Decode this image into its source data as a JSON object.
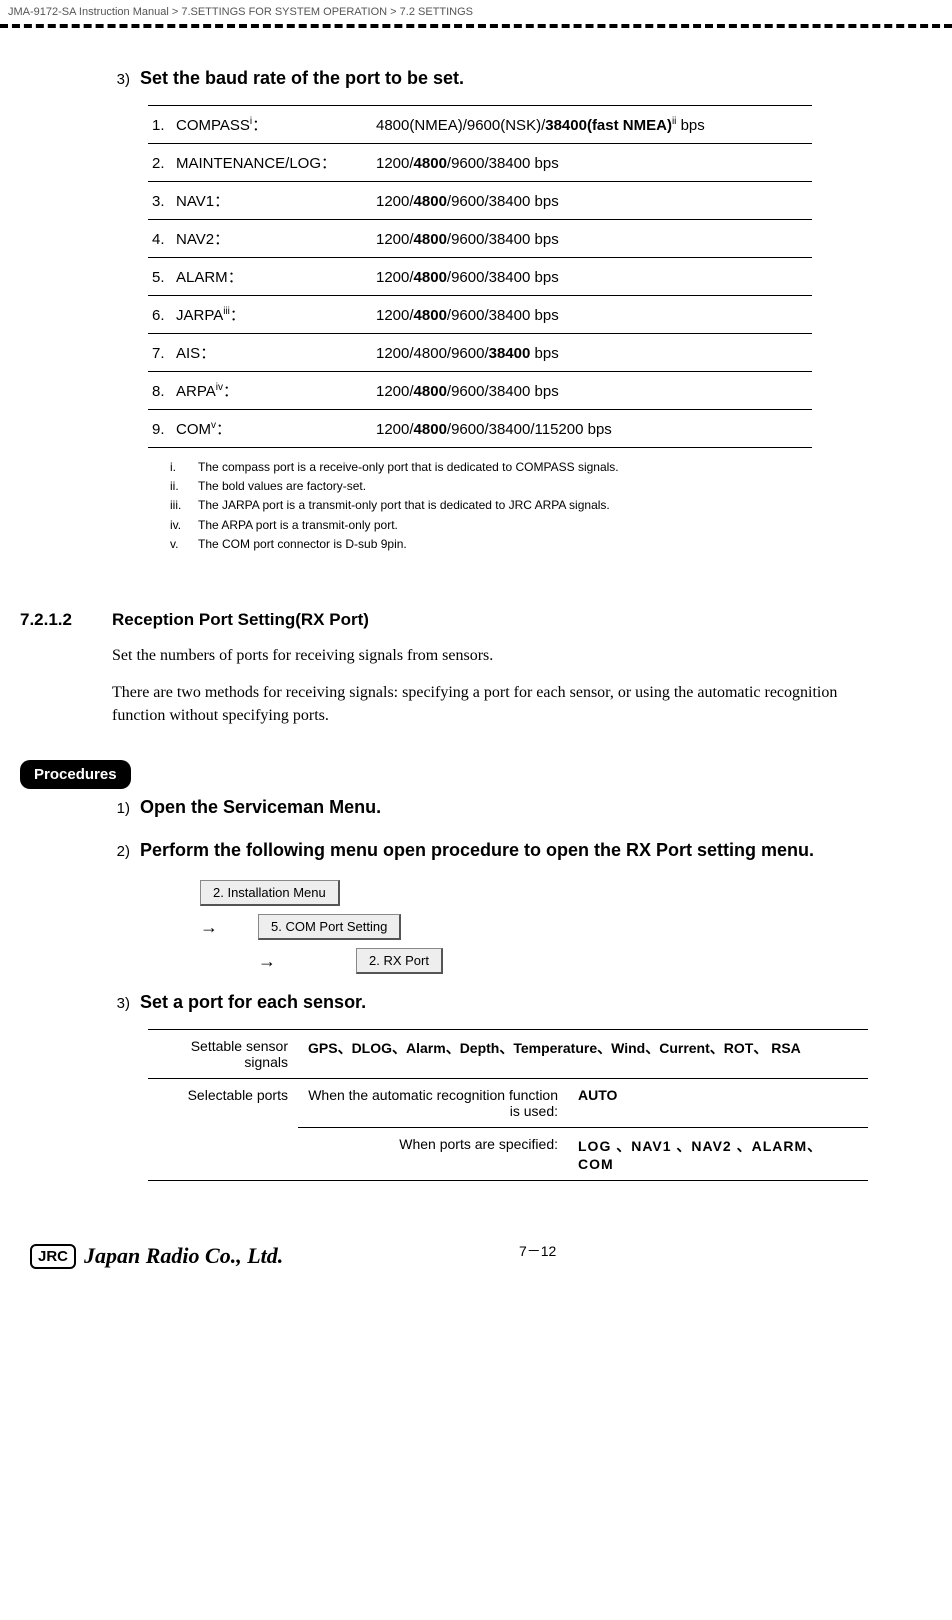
{
  "header": {
    "breadcrumb": "JMA-9172-SA Instruction Manual > 7.SETTINGS FOR SYSTEM OPERATION > 7.2  SETTINGS"
  },
  "step3": {
    "num": "3)",
    "text": "Set the baud rate of the port to be set."
  },
  "baud_table": [
    {
      "idx": "1.",
      "label": "COMPASS",
      "sup": "i",
      "colon": "：",
      "value_pre": "4800(NMEA)/9600(NSK)/",
      "value_bold": "38400(fast NMEA)",
      "value_sup": "ii",
      "value_post": " bps"
    },
    {
      "idx": "2.",
      "label": "MAINTENANCE/LOG",
      "sup": "",
      "colon": "：",
      "value_pre": "1200/",
      "value_bold": "4800",
      "value_sup": "",
      "value_post": "/9600/38400 bps"
    },
    {
      "idx": "3.",
      "label": "NAV1",
      "sup": "",
      "colon": "：",
      "value_pre": "1200/",
      "value_bold": "4800",
      "value_sup": "",
      "value_post": "/9600/38400 bps"
    },
    {
      "idx": "4.",
      "label": "NAV2",
      "sup": "",
      "colon": "：",
      "value_pre": "1200/",
      "value_bold": "4800",
      "value_sup": "",
      "value_post": "/9600/38400 bps"
    },
    {
      "idx": "5.",
      "label": "ALARM",
      "sup": "",
      "colon": "：",
      "value_pre": "1200/",
      "value_bold": "4800",
      "value_sup": "",
      "value_post": "/9600/38400 bps"
    },
    {
      "idx": "6.",
      "label": "JARPA",
      "sup": "iii",
      "colon": "：",
      "value_pre": "1200/",
      "value_bold": "4800",
      "value_sup": "",
      "value_post": "/9600/38400 bps"
    },
    {
      "idx": "7.",
      "label": "AIS",
      "sup": "",
      "colon": "：",
      "value_pre": "1200/4800/9600/",
      "value_bold": "38400",
      "value_sup": "",
      "value_post": " bps"
    },
    {
      "idx": "8.",
      "label": "ARPA",
      "sup": "iv",
      "colon": "：",
      "value_pre": "1200/",
      "value_bold": "4800",
      "value_sup": "",
      "value_post": "/9600/38400 bps"
    },
    {
      "idx": "9.",
      "label": "COM",
      "sup": "v",
      "colon": "：",
      "value_pre": "1200/",
      "value_bold": "4800",
      "value_sup": "",
      "value_post": "/9600/38400/115200 bps"
    }
  ],
  "footnotes": [
    {
      "key": "i.",
      "text": "The compass port is a receive-only port that is dedicated to COMPASS signals."
    },
    {
      "key": "ii.",
      "text": "The bold values are factory-set."
    },
    {
      "key": "iii.",
      "text": "The JARPA port is a transmit-only port that is dedicated to JRC ARPA signals."
    },
    {
      "key": "iv.",
      "text": "The ARPA port is a transmit-only port."
    },
    {
      "key": "v.",
      "text": "The COM port connector is D-sub 9pin."
    }
  ],
  "section": {
    "number": "7.2.1.2",
    "title": "Reception Port Setting(RX Port)"
  },
  "body": {
    "p1": "Set the numbers of ports for receiving signals from sensors.",
    "p2": "There are two methods for receiving signals: specifying a port for each sensor, or using the automatic recognition function without specifying ports."
  },
  "procedures_label": "Procedures",
  "proc_steps": {
    "s1": {
      "num": "1)",
      "text": "Open the Serviceman Menu."
    },
    "s2": {
      "num": "2)",
      "text": "Perform the following menu open procedure to open the RX Port setting menu."
    },
    "s3": {
      "num": "3)",
      "text": "Set a port for each sensor."
    }
  },
  "menu_path": {
    "b1": "2. Installation Menu",
    "b2": "5. COM Port Setting",
    "b3": "2. RX Port",
    "arrow": "→"
  },
  "settable": {
    "row1_label": "Settable sensor signals",
    "row1_val": "GPS、DLOG、Alarm、Depth、Temperature、Wind、Current、ROT、 RSA",
    "row2_label": "Selectable ports",
    "row2a_mid": "When the automatic recognition function is used:",
    "row2a_val": "AUTO",
    "row2b_mid": "When ports are specified:",
    "row2b_val": "LOG 、NAV1 、NAV2 、ALARM、 COM"
  },
  "footer": {
    "logo_box": "JRC",
    "logo_script": "Japan Radio Co., Ltd.",
    "page": "7－12"
  }
}
